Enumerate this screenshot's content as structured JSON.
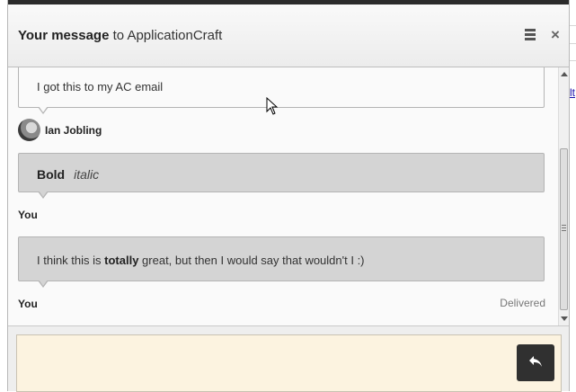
{
  "header": {
    "title_bold": "Your message",
    "title_rest": " to ApplicationCraft",
    "menu_icon": "hamburger-menu-icon",
    "close_icon": "close-icon",
    "close_glyph": "×"
  },
  "messages": [
    {
      "text": "I got this to my AC email",
      "style": "light"
    },
    {
      "sender": "Ian Jobling",
      "avatar": "avatar-photo"
    },
    {
      "bold": "Bold",
      "italic": "italic",
      "style": "dark"
    },
    {
      "sender": "You"
    },
    {
      "before": "I think this is ",
      "bold": "totally",
      "after": " great, but then I would say that wouldn't I :)",
      "style": "dark"
    },
    {
      "sender": "You",
      "status": "Delivered"
    }
  ],
  "compose": {
    "value": "",
    "send_icon": "reply-arrow-icon"
  },
  "colors": {
    "header_bar": "#2b2b2b",
    "dark_bubble": "#d4d4d4",
    "compose_bg": "#fcf3e0",
    "send_button": "#303030"
  },
  "background": {
    "link_text": "lt"
  }
}
